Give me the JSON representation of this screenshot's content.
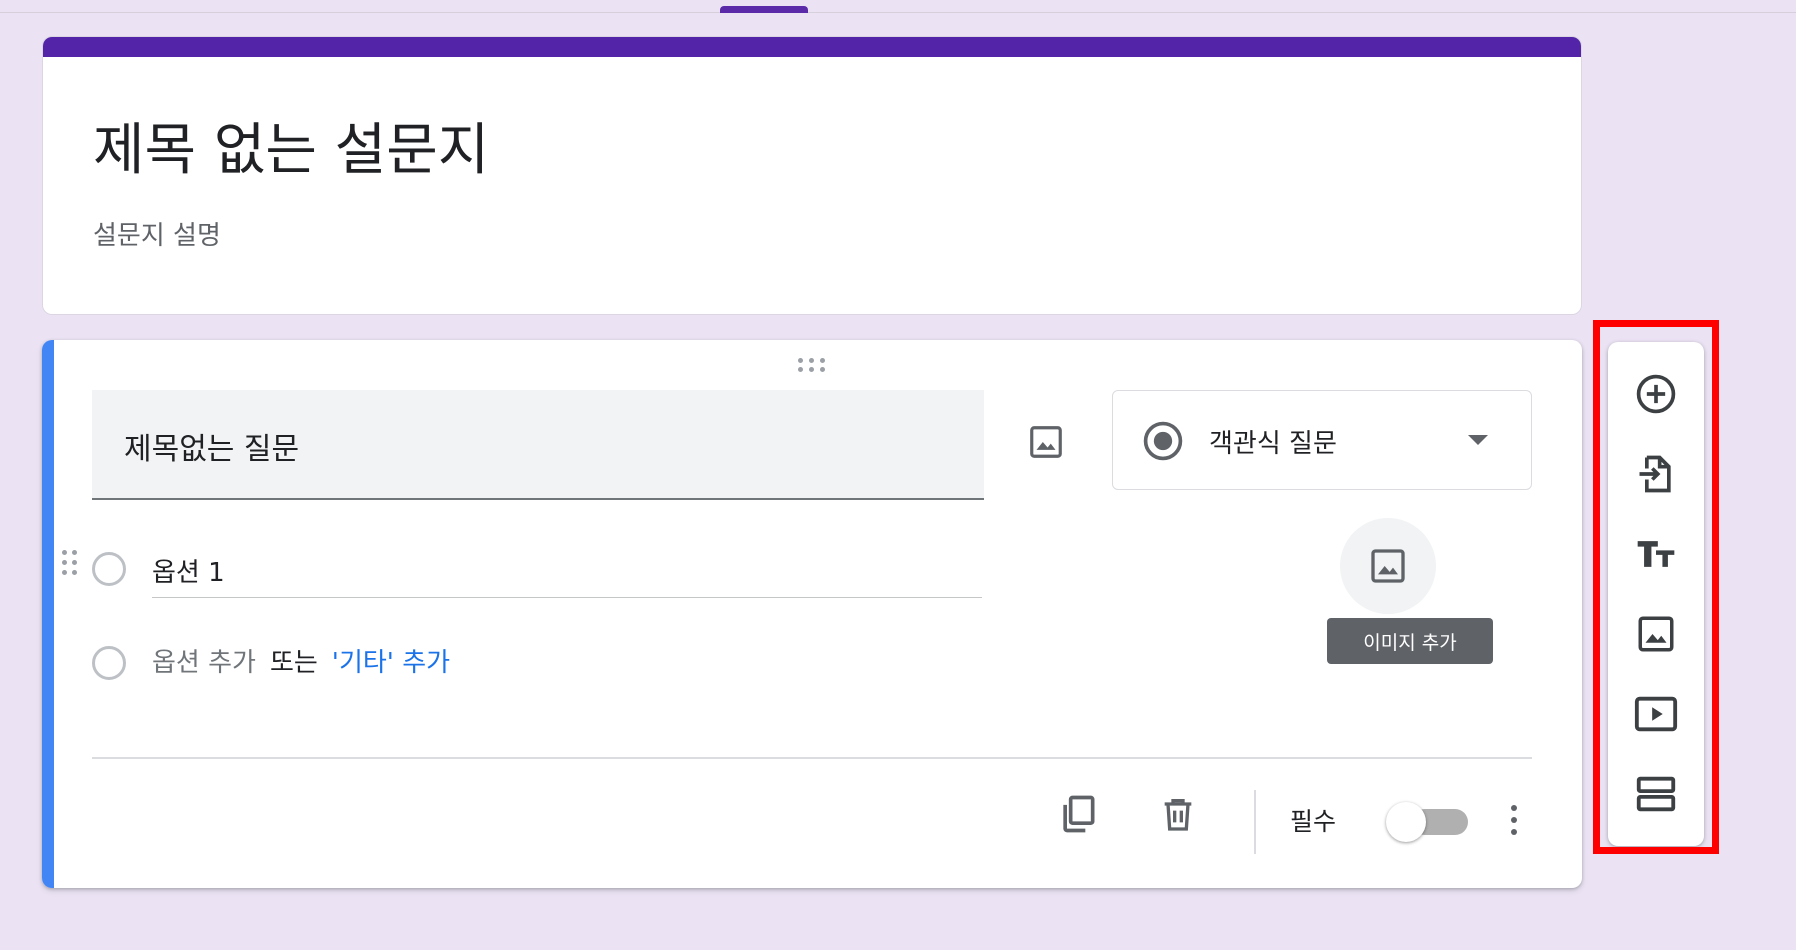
{
  "form": {
    "title": "제목 없는 설문지",
    "description": "설문지 설명"
  },
  "question": {
    "title": "제목없는 질문",
    "type_label": "객관식 질문",
    "options": [
      {
        "label": "옵션 1"
      }
    ],
    "add_option_label": "옵션 추가",
    "or_label": "또는",
    "add_other_label": "'기타' 추가",
    "image_tooltip": "이미지 추가",
    "required_label": "필수",
    "required_on": false
  },
  "colors": {
    "header_accent": "#5324a8",
    "question_accent": "#4285f4",
    "highlight_box": "#ff0000",
    "link": "#1a73e8"
  },
  "toolbar": {
    "items": [
      {
        "icon": "add-circle-icon"
      },
      {
        "icon": "import-question-icon"
      },
      {
        "icon": "title-text-icon"
      },
      {
        "icon": "image-icon"
      },
      {
        "icon": "video-icon"
      },
      {
        "icon": "section-icon"
      }
    ]
  }
}
